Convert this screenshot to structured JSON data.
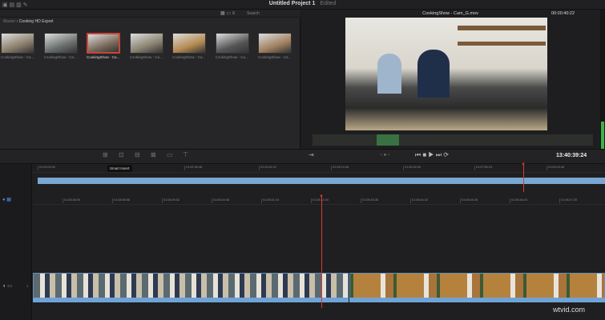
{
  "header": {
    "title": "Untitled Project 1",
    "status": "Edited"
  },
  "media_pool": {
    "search_placeholder": "Search",
    "breadcrumb": [
      "Master",
      "Cooking HD Export"
    ],
    "clips": [
      {
        "label": "CookingShow - Ca...",
        "selected": false
      },
      {
        "label": "CookingShow - Ca...",
        "selected": false
      },
      {
        "label": "CookingShow - Ca...",
        "selected": true
      },
      {
        "label": "CookingShow - Ca...",
        "selected": false
      },
      {
        "label": "CookingShow - Ca...",
        "selected": false
      },
      {
        "label": "CookingShow - Ca...",
        "selected": false
      },
      {
        "label": "CookingShow - Ca...",
        "selected": false
      }
    ]
  },
  "viewer": {
    "clip_name": "CookingShow - Cam_G.mov",
    "timecode": "00:00:40:22"
  },
  "toolbar": {
    "tooltip": "Smart Insert",
    "timecode": "13:40:39:24",
    "icons": [
      "smart-insert-icon",
      "append-icon",
      "ripple-overwrite-icon",
      "close-up-icon",
      "place-on-top-icon",
      "source-overwrite-icon"
    ]
  },
  "timeline": {
    "upper_ruler": [
      "01:00:00:00",
      "01:02:36:48",
      "01:03:52:12",
      "01:05:13:36",
      "01:06:32:00",
      "01:07:55:24",
      "01:09:09:48"
    ],
    "lower_ruler": [
      "01:08:38:00",
      "01:08:38:56",
      "01:08:39:52",
      "01:08:40:48",
      "01:08:41:44",
      "01:08:42:40",
      "01:08:43:36",
      "01:08:44:32",
      "01:08:45:28",
      "01:08:46:24",
      "01:08:47:20"
    ],
    "track_number": "1",
    "playhead_color": "#d9392f",
    "clip_color": "#7aa6d2"
  },
  "watermark": "wtvid.com"
}
